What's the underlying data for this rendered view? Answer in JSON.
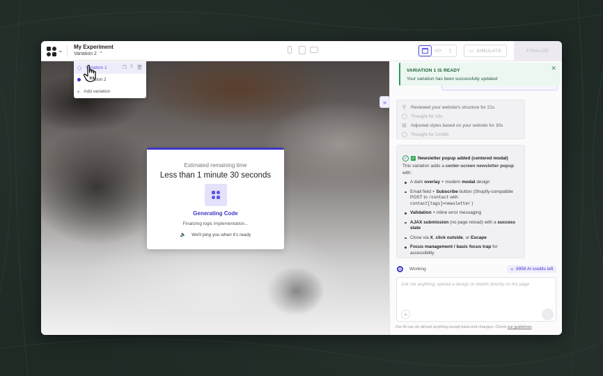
{
  "header": {
    "experiment_title": "My Experiment",
    "current_variation": "Variation 2",
    "simulate_label": "SIMULATE",
    "finalize_label": "FINALIZE"
  },
  "variation_menu": {
    "items": [
      {
        "label": "Variation 1",
        "selected": true
      },
      {
        "label": "Variation 2",
        "selected": false
      }
    ],
    "add_label": "Add variation"
  },
  "loader": {
    "subtitle": "Estimated remaining time",
    "title": "Less than 1 minute 30 seconds",
    "status": "Generating Code",
    "detail": "Finalizing logic implementation...",
    "notice": "We'll ping you when it's ready"
  },
  "toast": {
    "title": "VARIATION 1 IS READY",
    "message": "Your variation has been successfully updated"
  },
  "thoughts": [
    {
      "icon": "search-icon",
      "text": "Reviewed your website's structure for 21s"
    },
    {
      "icon": "lightbulb-icon",
      "text": "Thought for 10s"
    },
    {
      "icon": "palette-icon",
      "text": "Adjusted styles based on your website for 30s"
    },
    {
      "icon": "lightbulb-icon",
      "text": "Thought for 1m08s"
    }
  ],
  "message": {
    "heading": "Newsletter popup added (centered modal)",
    "intro_prefix": "This variation adds a ",
    "intro_bold": "center-screen newsletter popup",
    "intro_suffix": " with:",
    "bullets": {
      "b1_pre": "A dark ",
      "b1_b1": "overlay",
      "b1_mid": " + modern ",
      "b1_b2": "modal",
      "b1_post": " design",
      "b2_pre": "Email field + ",
      "b2_b1": "Subscribe",
      "b2_mid": " button (Shopify-compatible POST to ",
      "b2_code1": "/contact",
      "b2_mid2": " with ",
      "b2_code2": "contact[tags]=newsletter",
      "b2_post": " )",
      "b3_b1": "Validation",
      "b3_post": " + inline error messaging",
      "b4_b1": "AJAX submission",
      "b4_mid": " (no page reload) with a ",
      "b4_b2": "success state",
      "b5_pre": "Close via ",
      "b5_b1": "X",
      "b5_mid": ", ",
      "b5_b2": "click outside",
      "b5_mid2": ", or ",
      "b5_b3": "Escape",
      "b6_b1": "Focus management / basic focus trap",
      "b6_post": " for accessibility"
    }
  },
  "status": {
    "working_label": "Working",
    "credits_label": "9959 AI credits left"
  },
  "chat_input": {
    "placeholder": "Ask me anything, upload a design or sketch directly on the page"
  },
  "footer": {
    "note": "Our AI can do almost anything except back-end changes. Check ",
    "link": "our guidelines",
    "end": "."
  },
  "colors": {
    "accent": "#3b35c9",
    "success": "#2a9a58",
    "backdrop": "#1f2a25"
  }
}
